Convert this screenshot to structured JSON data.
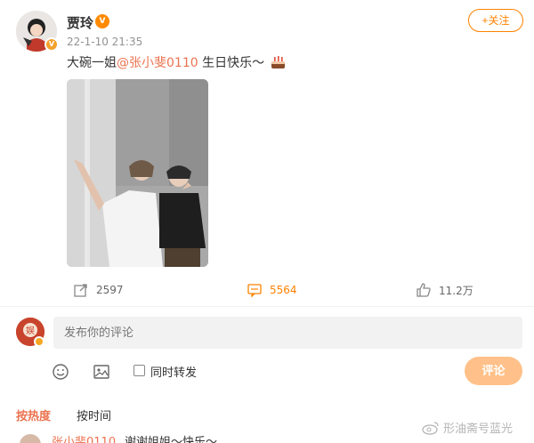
{
  "post": {
    "username": "贾玲",
    "timestamp": "22-1-10 21:35",
    "follow_label": "+关注",
    "content_prefix": "大碗一姐",
    "mention": "@张小斐0110",
    "content_suffix": " 生日快乐～",
    "photo_alt": "photo",
    "actions": {
      "repost_count": "2597",
      "comment_count": "5564",
      "like_count": "11.2万"
    }
  },
  "composer": {
    "placeholder": "发布你的评论",
    "repost_label": "同时转发",
    "submit_label": "评论"
  },
  "sort": {
    "hot_label": "按热度",
    "time_label": "按时间"
  },
  "comment_preview": {
    "user": "张小斐0110",
    "text": "谢谢姐姐～快乐～"
  },
  "watermark": {
    "text": "形油斋号蓝光"
  },
  "colors": {
    "accent": "#ff8200",
    "mention": "#eb7350",
    "submit_disabled": "#ffc189",
    "input_bg": "#f2f2f2"
  }
}
